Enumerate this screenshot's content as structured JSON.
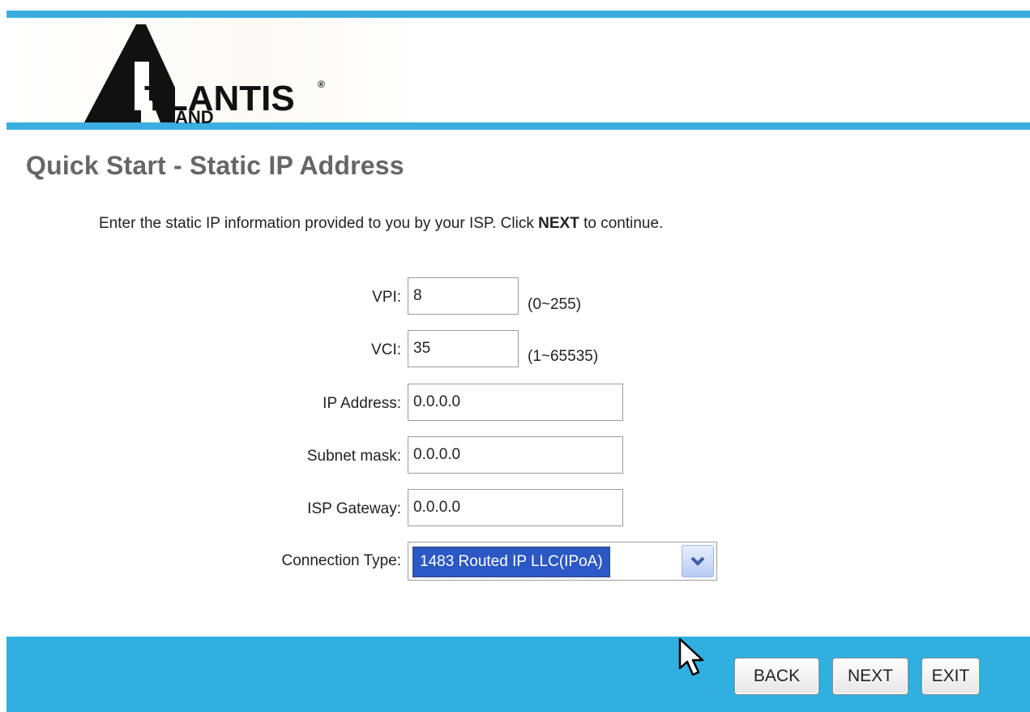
{
  "header": {
    "brand_main": "TLANTIS",
    "brand_sub": "AND",
    "brand_mark": "®"
  },
  "page": {
    "title": "Quick Start - Static IP Address",
    "instruction_before": "Enter the static IP information provided to you by your ISP. Click ",
    "instruction_bold": "NEXT",
    "instruction_after": " to continue."
  },
  "form": {
    "vpi": {
      "label": "VPI:",
      "value": "8",
      "hint": "(0~255)"
    },
    "vci": {
      "label": "VCI:",
      "value": "35",
      "hint": "(1~65535)"
    },
    "ip_address": {
      "label": "IP Address:",
      "value": "0.0.0.0"
    },
    "subnet_mask": {
      "label": "Subnet mask:",
      "value": "0.0.0.0"
    },
    "isp_gateway": {
      "label": "ISP Gateway:",
      "value": "0.0.0.0"
    },
    "connection_type": {
      "label": "Connection Type:",
      "value": "1483 Routed IP LLC(IPoA)"
    }
  },
  "footer": {
    "back_label": "BACK",
    "next_label": "NEXT",
    "exit_label": "EXIT"
  },
  "colors": {
    "accent_blue": "#3aaee0",
    "footer_blue": "#2fb0e0",
    "title_gray": "#666666",
    "selection_blue": "#2b58c4"
  }
}
